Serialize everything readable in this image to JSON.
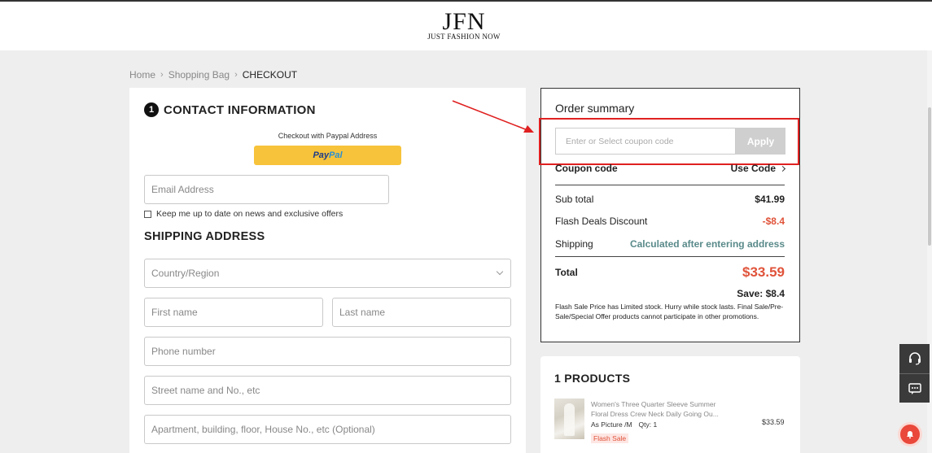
{
  "header": {
    "logo_main": "JFN",
    "logo_sub": "JUST FASHION NOW"
  },
  "breadcrumb": {
    "items": [
      "Home",
      "Shopping Bag",
      "CHECKOUT"
    ]
  },
  "contact": {
    "step_number": "1",
    "title": "CONTACT INFORMATION",
    "paypal_note": "Checkout with Paypal Address",
    "paypal_label_a": "Pay",
    "paypal_label_b": "Pal",
    "email_placeholder": "Email Address",
    "newsletter_label": "Keep me up to date on news and exclusive offers",
    "newsletter_checked": false
  },
  "shipping": {
    "title": "SHIPPING ADDRESS",
    "country_placeholder": "Country/Region",
    "first_name_placeholder": "First name",
    "last_name_placeholder": "Last name",
    "phone_placeholder": "Phone number",
    "street_placeholder": "Street name and No., etc",
    "apartment_placeholder": "Apartment, building, floor, House No., etc (Optional)"
  },
  "order_summary": {
    "title": "Order summary",
    "coupon_placeholder": "Enter or Select coupon code",
    "apply_label": "Apply",
    "coupon_label": "Coupon code",
    "use_code_label": "Use Code",
    "subtotal_label": "Sub total",
    "subtotal_value": "$41.99",
    "discount_label": "Flash Deals Discount",
    "discount_value": "-$8.4",
    "shipping_label": "Shipping",
    "shipping_value": "Calculated after entering address",
    "total_label": "Total",
    "total_value": "$33.59",
    "save_text": "Save: $8.4",
    "note": "Flash Sale Price has Limited stock. Hurry while stock lasts. Final Sale/Pre-Sale/Special Offer products cannot participate in other promotions."
  },
  "products": {
    "title": "1 PRODUCTS",
    "items": [
      {
        "name": "Women's Three Quarter Sleeve Summer Floral Dress Crew Neck Daily Going Ou...",
        "variant": "As Picture /M",
        "qty": "Qty: 1",
        "price": "$33.59",
        "badge": "Flash Sale"
      }
    ]
  },
  "colors": {
    "accent_red": "#e0533a",
    "highlight_box": "#e02020",
    "paypal_yellow": "#f7c33a",
    "shipping_teal": "#5a8a8a"
  }
}
